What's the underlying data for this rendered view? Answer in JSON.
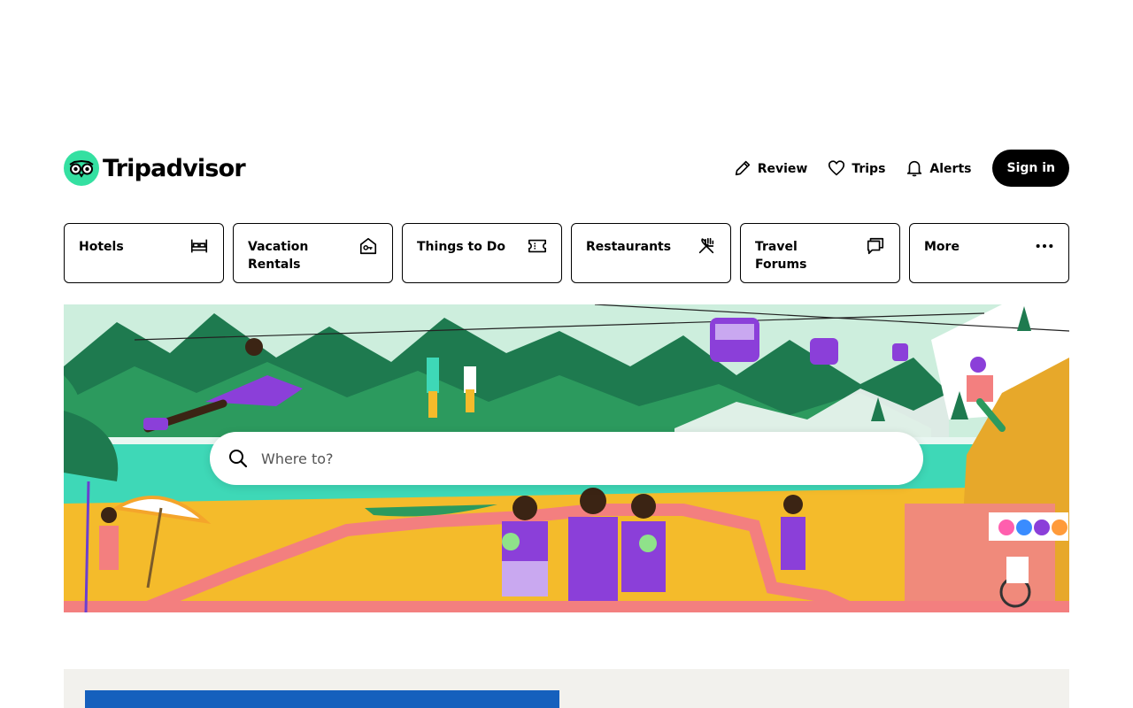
{
  "brand": {
    "name": "Tripadvisor",
    "accent": "#34e0a1"
  },
  "header": {
    "review_label": "Review",
    "trips_label": "Trips",
    "alerts_label": "Alerts",
    "signin_label": "Sign in"
  },
  "categories": [
    {
      "label": "Hotels",
      "icon": "bed-icon"
    },
    {
      "label": "Vacation Rentals",
      "icon": "house-key-icon"
    },
    {
      "label": "Things to Do",
      "icon": "ticket-icon"
    },
    {
      "label": "Restaurants",
      "icon": "fork-knife-icon"
    },
    {
      "label": "Travel Forums",
      "icon": "chat-bubbles-icon"
    },
    {
      "label": "More",
      "icon": "more-dots-icon"
    }
  ],
  "search": {
    "placeholder": "Where to?",
    "icon": "search-icon"
  },
  "colors": {
    "ground_yellow": "#f4bb2b",
    "sea_teal": "#3ed8b7",
    "mountain_green": "#1e7a4f",
    "path_pink": "#f37f7f",
    "purple": "#8b3fd9",
    "bottom_blue": "#1560bd"
  }
}
